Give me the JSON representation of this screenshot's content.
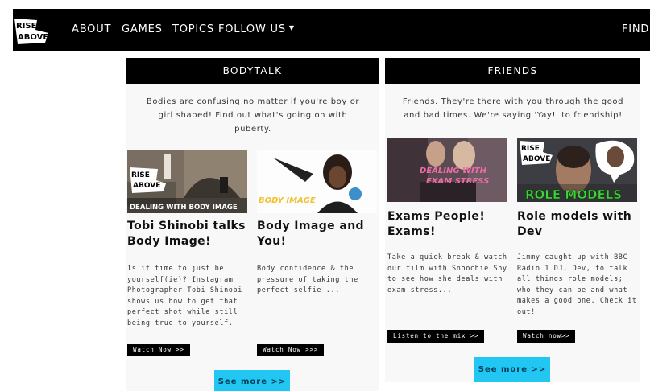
{
  "nav": {
    "logo_line1": "RISE",
    "logo_line2": "ABOVE",
    "about": "ABOUT",
    "games": "GAMES",
    "topics": "TOPICS",
    "follow": "FOLLOW US",
    "find": "FIND"
  },
  "columns": [
    {
      "title": "BODYTALK",
      "description": "Bodies are confusing no matter if you're boy or girl shaped! Find out what's going on with puberty.",
      "cards": [
        {
          "thumb_caption": "DEALING WITH BODY IMAGE",
          "thumb_logo_1": "RISE",
          "thumb_logo_2": "ABOVE",
          "title": "Tobi Shinobi talks Body Image!",
          "text": "Is it time to just be yourself(ie)? Instagram Photographer Tobi Shinobi shows us how to get that perfect shot while still being true to yourself.",
          "button": "Watch Now >>"
        },
        {
          "thumb_caption": "BODY IMAGE",
          "title": "Body Image and You!",
          "text": "Body confidence & the pressure of taking the perfect selfie ...",
          "button": "Watch Now >>>"
        }
      ],
      "see_more": "See more >>"
    },
    {
      "title": "FRIENDS",
      "description": "Friends. They're there with you through the good and bad times. We're saying 'Yay!' to friendship!",
      "cards": [
        {
          "thumb_caption_1": "DEALING WITH",
          "thumb_caption_2": "EXAM STRESS",
          "title": "Exams People! Exams!",
          "text": "Take a quick break & watch our film with Snoochie Shy to see how she deals with exam stress...",
          "button": "Listen to the mix >>"
        },
        {
          "thumb_caption": "ROLE MODELS",
          "thumb_logo_1": "RISE",
          "thumb_logo_2": "ABOVE",
          "title": "Role models with Dev",
          "text": "Jimmy caught up with BBC Radio 1 DJ, Dev, to talk all things role models; who they can be and what makes a good one. Check it out!",
          "button": "Watch now>>"
        }
      ],
      "see_more": "See more >>"
    }
  ],
  "colors": {
    "accent": "#21c6f3",
    "header_bg": "#000000",
    "column_bg": "#f8f8f8",
    "role_models_green": "#3fd43a",
    "body_image_yellow": "#f2c12e",
    "exam_pink": "#f06aa8"
  }
}
